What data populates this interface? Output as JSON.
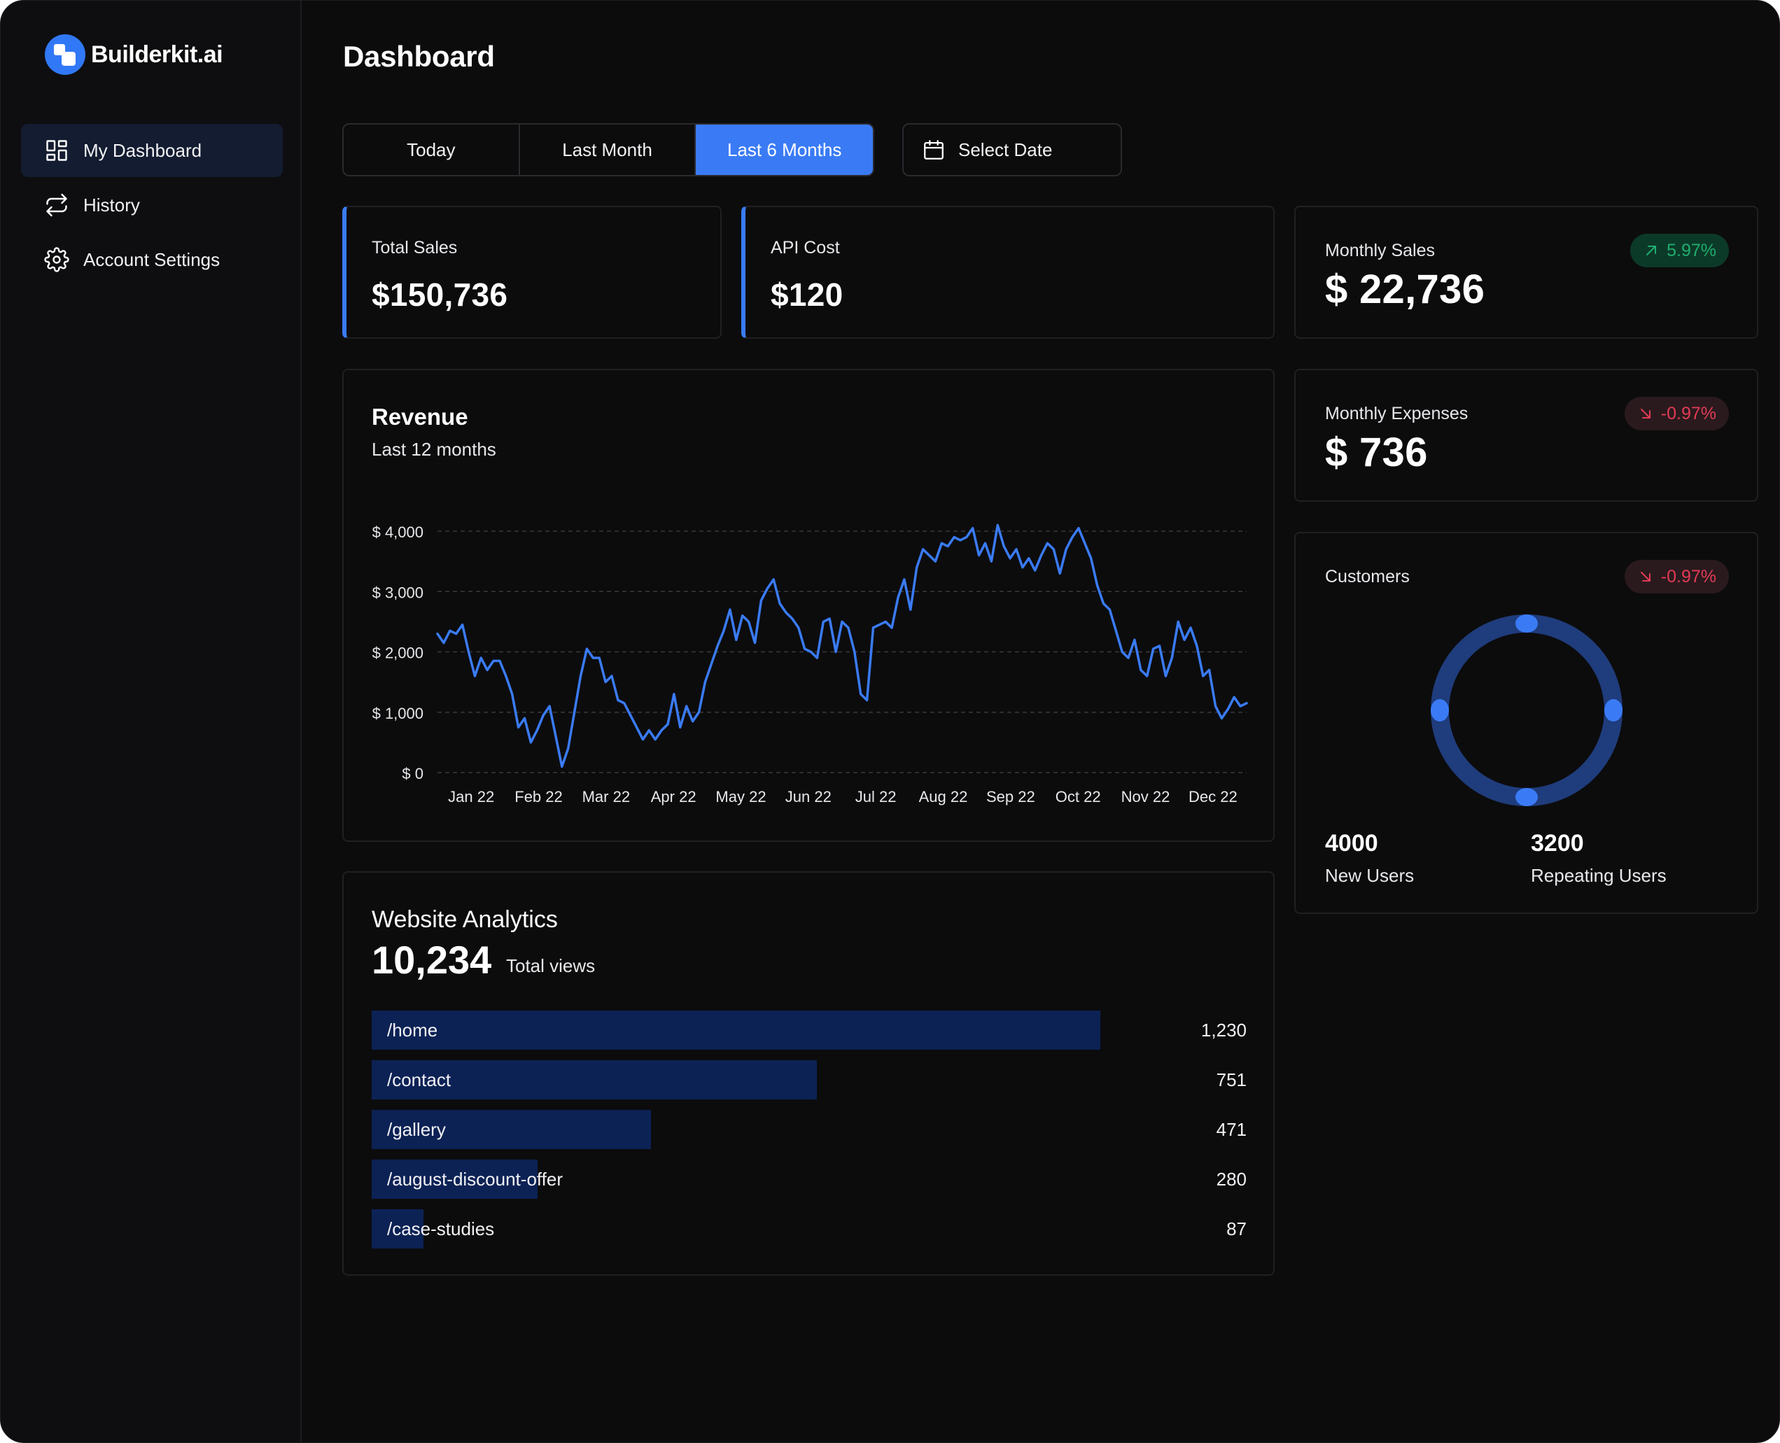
{
  "brand": {
    "name": "Builderkit.ai"
  },
  "sidebar": {
    "items": [
      {
        "label": "My Dashboard",
        "icon": "dashboard-icon",
        "active": true
      },
      {
        "label": "History",
        "icon": "repeat-icon",
        "active": false
      },
      {
        "label": "Account Settings",
        "icon": "gear-icon",
        "active": false
      }
    ]
  },
  "header": {
    "title": "Dashboard"
  },
  "filters": {
    "options": [
      "Today",
      "Last Month",
      "Last 6 Months"
    ],
    "selected": "Last 6 Months",
    "date_label": "Select Date"
  },
  "stats": {
    "total_sales": {
      "label": "Total Sales",
      "value": "$150,736"
    },
    "api_cost": {
      "label": "API Cost",
      "value": "$120"
    },
    "monthly_sales": {
      "label": "Monthly Sales",
      "value": "$ 22,736",
      "change": "5.97%",
      "trend": "up"
    },
    "monthly_expenses": {
      "label": "Monthly Expenses",
      "value": "$ 736",
      "change": "-0.97%",
      "trend": "down"
    }
  },
  "revenue": {
    "title": "Revenue",
    "subtitle": "Last 12 months"
  },
  "chart_data": {
    "type": "line",
    "title": "Revenue",
    "subtitle": "Last 12 months",
    "categories": [
      "Jan 22",
      "Feb 22",
      "Mar 22",
      "Apr 22",
      "May 22",
      "Jun 22",
      "Jul 22",
      "Aug 22",
      "Sep 22",
      "Oct 22",
      "Nov 22",
      "Dec 22"
    ],
    "y_ticks": [
      "$ 0",
      "$ 1,000",
      "$ 2,000",
      "$ 3,000",
      "$ 4,000"
    ],
    "ylim": [
      0,
      4000
    ],
    "grid": true,
    "series": [
      {
        "values": [
          2300,
          2150,
          2350,
          2300,
          2450,
          2000,
          1600,
          1900,
          1700,
          1850,
          1850,
          1600,
          1300,
          750,
          900,
          500,
          700,
          950,
          1100,
          600,
          100,
          400,
          1000,
          1600,
          2050,
          1900,
          1900,
          1500,
          1600,
          1200,
          1150,
          950,
          750,
          550,
          700,
          550,
          700,
          800,
          1300,
          750,
          1100,
          850,
          1000,
          1500,
          1800,
          2100,
          2350,
          2700,
          2200,
          2600,
          2500,
          2150,
          2850,
          3050,
          3200,
          2800,
          2650,
          2550,
          2400,
          2050,
          2000,
          1900,
          2500,
          2550,
          2000,
          2500,
          2400,
          2000,
          1300,
          1200,
          2400,
          2450,
          2500,
          2400,
          2900,
          3200,
          2700,
          3400,
          3700,
          3600,
          3500,
          3800,
          3750,
          3900,
          3850,
          3900,
          4050,
          3600,
          3800,
          3500,
          4100,
          3750,
          3550,
          3700,
          3400,
          3550,
          3350,
          3600,
          3800,
          3700,
          3300,
          3700,
          3900,
          4050,
          3800,
          3550,
          3100,
          2800,
          2700,
          2350,
          2000,
          1900,
          2200,
          1700,
          1600,
          2050,
          2100,
          1600,
          1900,
          2500,
          2200,
          2400,
          2100,
          1600,
          1700,
          1100,
          900,
          1050,
          1250,
          1100,
          1150
        ]
      }
    ]
  },
  "analytics": {
    "title": "Website Analytics",
    "total": "10,234",
    "total_label": "Total views",
    "pages": [
      {
        "path": "/home",
        "count": "1,230",
        "value": 1230
      },
      {
        "path": "/contact",
        "count": "751",
        "value": 751
      },
      {
        "path": "/gallery",
        "count": "471",
        "value": 471
      },
      {
        "path": "/august-discount-offer",
        "count": "280",
        "value": 280
      },
      {
        "path": "/case-studies",
        "count": "87",
        "value": 87
      }
    ]
  },
  "customers": {
    "label": "Customers",
    "change": "-0.97%",
    "trend": "down",
    "new_users": {
      "value": "4000",
      "label": "New Users"
    },
    "repeating_users": {
      "value": "3200",
      "label": "Repeating Users"
    }
  },
  "colors": {
    "accent": "#3a7bf5",
    "positive": "#1fae6f",
    "negative": "#e23b55",
    "bar": "#0c2255",
    "ring": "#1f3c7c"
  }
}
